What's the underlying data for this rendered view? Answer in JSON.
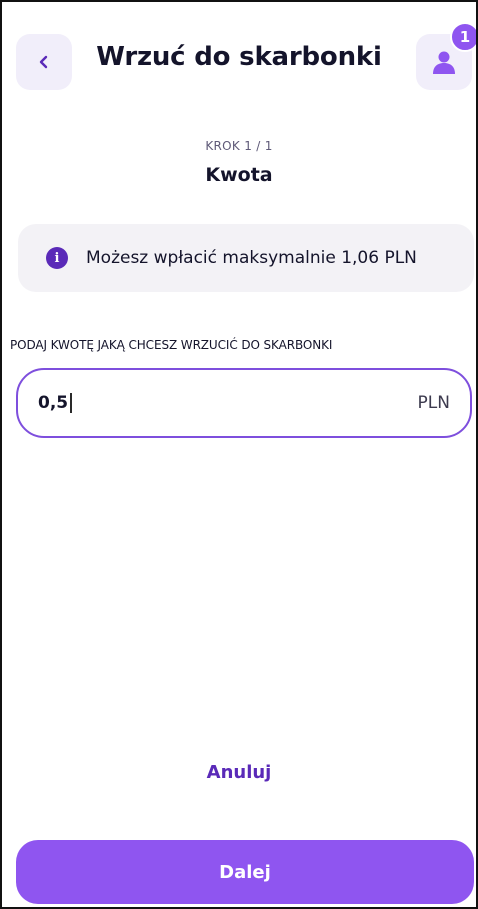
{
  "header": {
    "title": "Wrzuć do skarbonki",
    "back_icon": "chevron-left-icon",
    "avatar_icon": "user-icon",
    "notification_count": "1"
  },
  "step": {
    "label": "KROK 1 / 1",
    "title": "Kwota"
  },
  "info": {
    "icon": "info-icon",
    "text": "Możesz wpłacić maksymalnie 1,06 PLN"
  },
  "amount": {
    "label": "PODAJ KWOTĘ JAKĄ CHCESZ WRZUCIĆ DO SKARBONKI",
    "value": "0,5",
    "currency": "PLN"
  },
  "actions": {
    "cancel_label": "Anuluj",
    "next_label": "Dalej"
  },
  "colors": {
    "accent": "#8f55f0",
    "accent_dark": "#5a2ab8",
    "tile_bg": "#f1eefa",
    "info_bg": "#f3f2f6"
  }
}
